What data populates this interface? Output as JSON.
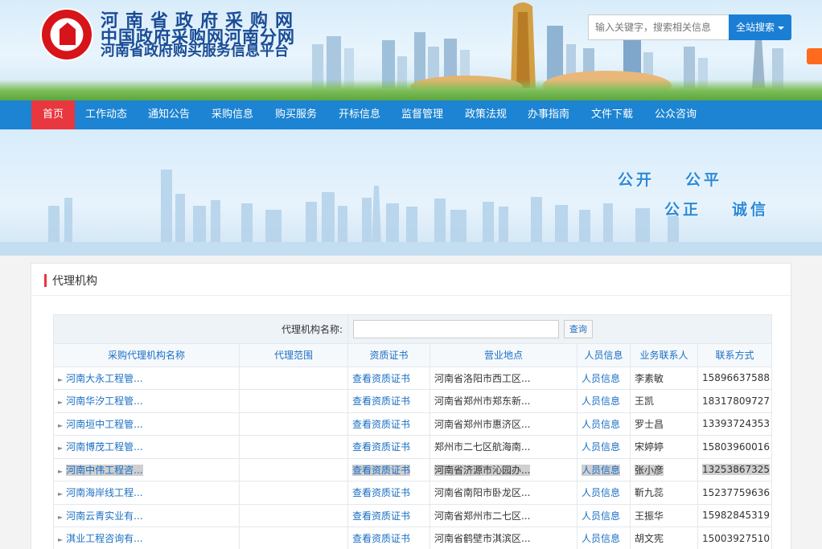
{
  "header": {
    "logo_line1": "河南省政府采购网",
    "logo_line2": "中国政府采购网河南分网",
    "logo_line3": "河南省政府购买服务信息平台",
    "search_placeholder": "输入关键字，搜索相关信息",
    "search_button": "全站搜索"
  },
  "nav": {
    "items": [
      "首页",
      "工作动态",
      "通知公告",
      "采购信息",
      "购买服务",
      "开标信息",
      "监督管理",
      "政策法规",
      "办事指南",
      "文件下载",
      "公众咨询"
    ],
    "active_index": 0
  },
  "banner": {
    "slogan1": "公开",
    "slogan2": "公平",
    "slogan3": "公正",
    "slogan4": "诚信"
  },
  "panel": {
    "title": "代理机构",
    "filter_label": "代理机构名称:",
    "query_button": "查询",
    "columns": [
      "采购代理机构名称",
      "代理范围",
      "资质证书",
      "营业地点",
      "人员信息",
      "业务联系人",
      "联系方式"
    ],
    "rows": [
      {
        "name": "河南大永工程管...",
        "scope": "",
        "cert": "查看资质证书",
        "address": "河南省洛阳市西工区...",
        "staff": "人员信息",
        "contact": "李素敏",
        "phone": "15896637588"
      },
      {
        "name": "河南华汐工程管...",
        "scope": "",
        "cert": "查看资质证书",
        "address": "河南省郑州市郑东新...",
        "staff": "人员信息",
        "contact": "王凯",
        "phone": "18317809727"
      },
      {
        "name": "河南垣中工程管...",
        "scope": "",
        "cert": "查看资质证书",
        "address": "河南省郑州市惠济区...",
        "staff": "人员信息",
        "contact": "罗士昌",
        "phone": "13393724353"
      },
      {
        "name": "河南博茂工程管...",
        "scope": "",
        "cert": "查看资质证书",
        "address": "郑州市二七区航海南...",
        "staff": "人员信息",
        "contact": "宋婷婷",
        "phone": "15803960016"
      },
      {
        "name": "河南中伟工程咨...",
        "scope": "",
        "cert": "查看资质证书",
        "address": "河南省济源市沁园办...",
        "staff": "人员信息",
        "contact": "张小彦",
        "phone": "13253867325"
      },
      {
        "name": "河南海岸线工程...",
        "scope": "",
        "cert": "查看资质证书",
        "address": "河南省南阳市卧龙区...",
        "staff": "人员信息",
        "contact": "靳九蕊",
        "phone": "15237759636"
      },
      {
        "name": "河南云青实业有...",
        "scope": "",
        "cert": "查看资质证书",
        "address": "河南省郑州市二七区...",
        "staff": "人员信息",
        "contact": "王振华",
        "phone": "15982845319"
      },
      {
        "name": "淇业工程咨询有...",
        "scope": "",
        "cert": "查看资质证书",
        "address": "河南省鹤壁市淇滨区...",
        "staff": "人员信息",
        "contact": "胡文宪",
        "phone": "15003927510"
      }
    ],
    "highlighted_row_index": 4
  },
  "colors": {
    "nav_blue": "#1c84d2",
    "nav_active_red": "#e9373f",
    "link_blue": "#1a6fc4",
    "search_button_blue": "#1a7fd4"
  }
}
